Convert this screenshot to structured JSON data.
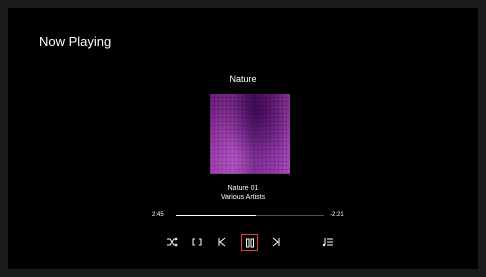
{
  "header": {
    "title": "Now Playing"
  },
  "album": {
    "name": "Nature",
    "art_colors": [
      "#8c2aa0",
      "#5d1677",
      "#b04ac0"
    ]
  },
  "track": {
    "title": "Nature 01",
    "artist": "Various Artists"
  },
  "progress": {
    "elapsed": "2:45",
    "remaining": "-2:21",
    "fraction": 0.54
  },
  "controls": [
    {
      "name": "shuffle",
      "icon": "shuffle-icon"
    },
    {
      "name": "repeat",
      "icon": "repeat-icon"
    },
    {
      "name": "previous",
      "icon": "skip-previous-icon"
    },
    {
      "name": "play-pause",
      "icon": "pause-icon",
      "focused": true,
      "focus_color": "#e03c3c"
    },
    {
      "name": "next",
      "icon": "skip-next-icon"
    },
    {
      "name": "queue",
      "icon": "queue-icon"
    }
  ]
}
